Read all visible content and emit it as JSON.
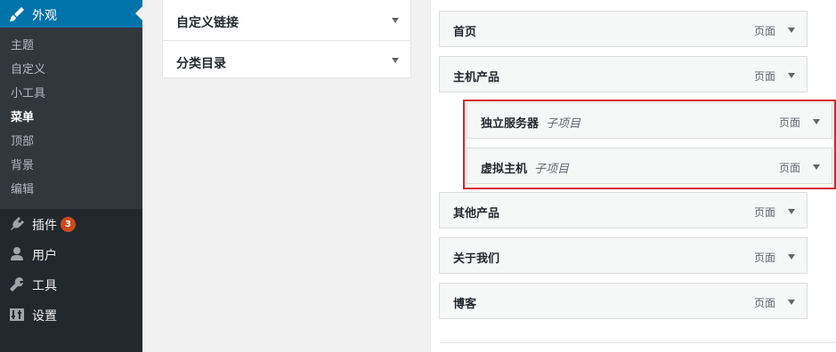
{
  "sidebar": {
    "current_menu": {
      "label": "外观",
      "icon": "paintbrush-icon"
    },
    "submenu": [
      {
        "label": "主题"
      },
      {
        "label": "自定义"
      },
      {
        "label": "小工具"
      },
      {
        "label": "菜单",
        "current": true
      },
      {
        "label": "顶部"
      },
      {
        "label": "背景"
      },
      {
        "label": "编辑"
      }
    ],
    "items": [
      {
        "label": "插件",
        "icon": "plugin-icon",
        "badge": "3"
      },
      {
        "label": "用户",
        "icon": "user-icon"
      },
      {
        "label": "工具",
        "icon": "wrench-icon"
      },
      {
        "label": "设置",
        "icon": "settings-icon"
      }
    ]
  },
  "accordion": [
    {
      "label": "自定义链接"
    },
    {
      "label": "分类目录"
    }
  ],
  "menu_items": [
    {
      "title": "首页",
      "type": "页面",
      "sub_label": ""
    },
    {
      "title": "主机产品",
      "type": "页面",
      "sub_label": ""
    },
    {
      "title": "独立服务器",
      "type": "页面",
      "sub_label": "子项目"
    },
    {
      "title": "虚拟主机",
      "type": "页面",
      "sub_label": "子项目"
    },
    {
      "title": "其他产品",
      "type": "页面",
      "sub_label": ""
    },
    {
      "title": "关于我们",
      "type": "页面",
      "sub_label": ""
    },
    {
      "title": "博客",
      "type": "页面",
      "sub_label": ""
    }
  ],
  "colors": {
    "sidebar_bg": "#23282d",
    "submenu_bg": "#32373c",
    "accent": "#0073aa",
    "badge": "#ca4a1f",
    "highlight": "#d6232d"
  }
}
